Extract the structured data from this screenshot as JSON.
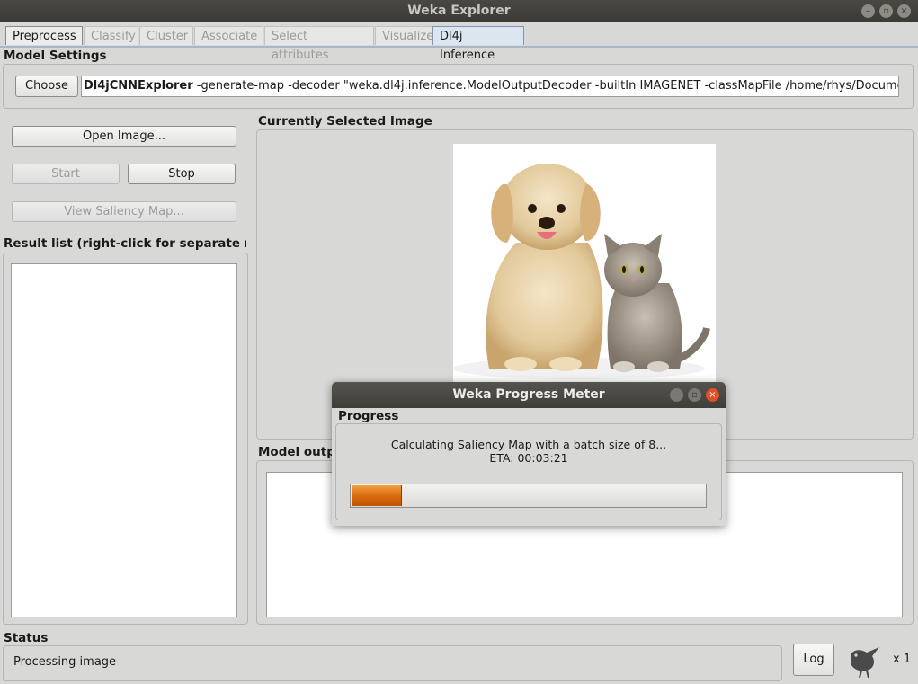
{
  "window": {
    "title": "Weka Explorer"
  },
  "tabs": [
    {
      "label": "Preprocess"
    },
    {
      "label": "Classify"
    },
    {
      "label": "Cluster"
    },
    {
      "label": "Associate"
    },
    {
      "label": "Select attributes"
    },
    {
      "label": "Visualize"
    },
    {
      "label": "Dl4j Inference"
    }
  ],
  "model_settings": {
    "label": "Model Settings",
    "choose_label": "Choose",
    "command_name": "Dl4jCNNExplorer",
    "command_args": " -generate-map -decoder \"weka.dl4j.inference.ModelOutputDecoder -builtIn IMAGENET -classMapFile /home/rhys/Documents/git/"
  },
  "controls": {
    "open_image_label": "Open Image...",
    "start_label": "Start",
    "stop_label": "Stop",
    "view_saliency_label": "View Saliency Map..."
  },
  "result_list": {
    "label": "Result list (right-click for separate r..."
  },
  "image_panel": {
    "label": "Currently Selected Image"
  },
  "model_output": {
    "label": "Model outpu"
  },
  "status": {
    "label": "Status",
    "text": "Processing image",
    "log_label": "Log",
    "count": "x 1"
  },
  "progress_dialog": {
    "title": "Weka Progress Meter",
    "section_label": "Progress",
    "message": "Calculating Saliency Map with a batch size of 8...",
    "eta": "ETA: 00:03:21",
    "progress_fraction": 0.14
  },
  "colors": {
    "progress_fill": "#d8680c",
    "titlebar": "#3b3a36"
  }
}
